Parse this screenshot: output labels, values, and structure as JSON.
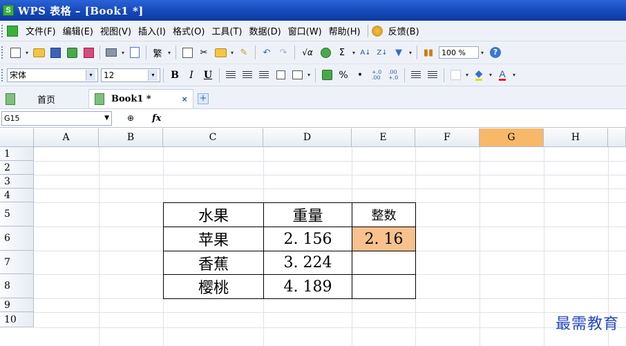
{
  "window": {
    "title": "WPS 表格 – [Book1 *]",
    "app_icon_letter": "S"
  },
  "menu": {
    "items": [
      "文件(F)",
      "编辑(E)",
      "视图(V)",
      "插入(I)",
      "格式(O)",
      "工具(T)",
      "数据(D)",
      "窗口(W)",
      "帮助(H)"
    ],
    "feedback": "反馈(B)"
  },
  "toolbar": {
    "traditional_label": "繁",
    "sqrt_label": "√α",
    "sum_label": "Σ",
    "zoom": "100 %",
    "help": "?"
  },
  "format": {
    "font_name": "宋体",
    "font_size": "12",
    "bold": "B",
    "italic": "I",
    "underline": "U",
    "percent": "%",
    "comma": "•",
    "inc_decimal": "+.0\n.00",
    "dec_decimal": ".00\n+.0",
    "font_color_letter": "A"
  },
  "tabs": {
    "home": "首页",
    "active": "Book1 *",
    "close": "×",
    "new": "+"
  },
  "formula_bar": {
    "name_box": "G15",
    "value": ""
  },
  "sheet": {
    "columns": [
      "A",
      "B",
      "C",
      "D",
      "E",
      "F",
      "G",
      "H"
    ],
    "selected_column": "G",
    "rows": [
      "1",
      "2",
      "3",
      "4",
      "5",
      "6",
      "7",
      "8",
      "9",
      "10"
    ],
    "cells": {
      "C5": "水果",
      "D5": "重量",
      "E5": "整数",
      "C6": "苹果",
      "D6": "2. 156",
      "E6": "2. 16",
      "C7": "香蕉",
      "D7": "3. 224",
      "C8": "樱桃",
      "D8": "4. 189"
    },
    "highlight_color": "#f8c18d",
    "selected_header_color": "#f7b869"
  },
  "watermark": "最需教育"
}
